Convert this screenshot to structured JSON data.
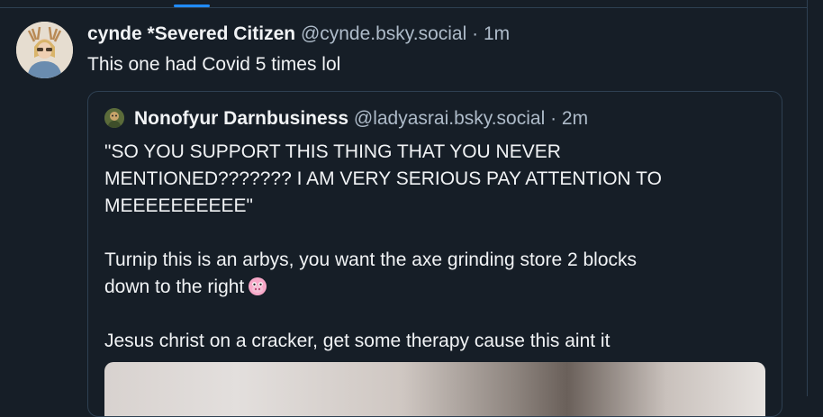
{
  "post": {
    "display_name": "cynde *Severed Citizen",
    "handle": "@cynde.bsky.social",
    "separator": "·",
    "time": "1m",
    "text": "This one had Covid 5 times lol"
  },
  "quote": {
    "display_name": "Nonofyur Darnbusiness",
    "handle": "@ladyasrai.bsky.social",
    "separator": "·",
    "time": "2m",
    "line1": "\"SO YOU SUPPORT THIS THING THAT YOU NEVER",
    "line2": "MENTIONED??????? I AM VERY SERIOUS PAY ATTENTION TO",
    "line3": "MEEEEEEEEEE\"",
    "line4": "Turnip this is an arbys, you want the axe grinding store 2 blocks",
    "line5": "down to the right",
    "line6": "Jesus christ on a cracker, get some therapy cause this aint it"
  },
  "icons": {
    "emoji": "face-emoji-icon"
  }
}
